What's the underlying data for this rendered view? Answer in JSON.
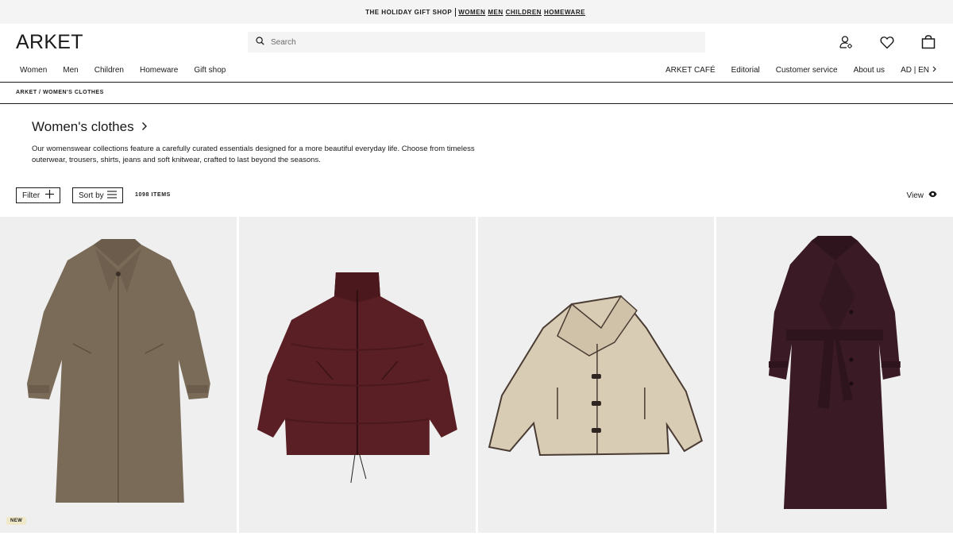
{
  "promo": {
    "lead": "THE HOLIDAY GIFT SHOP",
    "links": [
      "WOMEN",
      "MEN",
      "CHILDREN",
      "HOMEWARE"
    ]
  },
  "header": {
    "logo": "ARKET",
    "search_placeholder": "Search",
    "icons": [
      "account-icon",
      "heart-icon",
      "bag-icon"
    ]
  },
  "nav": {
    "left": [
      "Women",
      "Men",
      "Children",
      "Homeware",
      "Gift shop"
    ],
    "right": [
      "ARKET CAFÉ",
      "Editorial",
      "Customer service",
      "About us"
    ],
    "lang": "AD | EN"
  },
  "breadcrumb": "ARKET / WOMEN'S CLOTHES",
  "page": {
    "title": "Women's clothes",
    "description": "Our womenswear collections feature a carefully curated essentials designed for a more beautiful everyday life. Choose from timeless outerwear, trousers, shirts, jeans and soft knitwear, crafted to last beyond the seasons."
  },
  "controls": {
    "filter_label": "Filter",
    "sort_label": "Sort by",
    "item_count": "1098 ITEMS",
    "view_label": "View"
  },
  "products": [
    {
      "name": "product-brown-wool-coat",
      "color": "#7a6a58",
      "badge": "NEW"
    },
    {
      "name": "product-burgundy-puffer-jacket",
      "color": "#5a1f24",
      "badge": ""
    },
    {
      "name": "product-beige-shearling-jacket",
      "color": "#d8ccb4",
      "badge": ""
    },
    {
      "name": "product-burgundy-belted-coat",
      "color": "#3a1a24",
      "badge": ""
    }
  ],
  "colors": {
    "promo_bg": "#f4f4f4",
    "card_bg": "#efefef",
    "text": "#1a1a1a",
    "badge_bg": "#efe9c9"
  }
}
